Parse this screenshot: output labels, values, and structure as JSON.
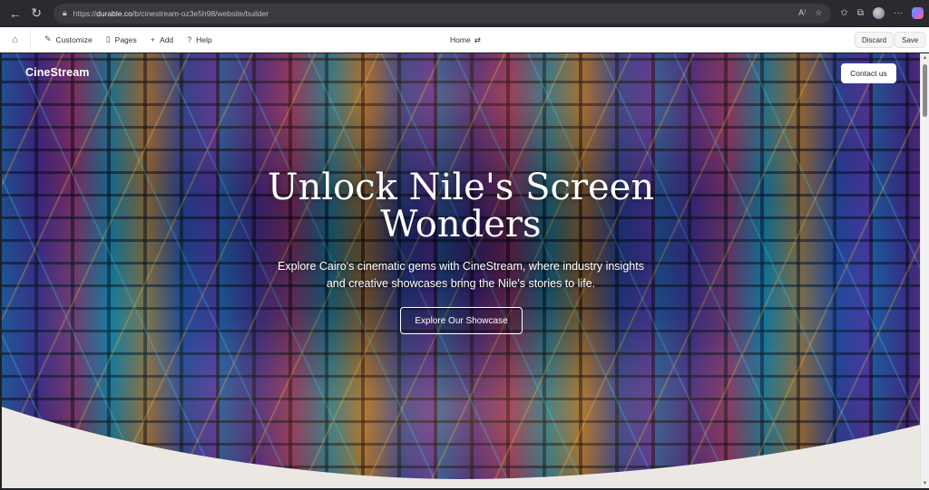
{
  "browser": {
    "url_protocol": "https://",
    "url_host": "durable.co",
    "url_path": "/b/cinestream-oz3e5h98/website/builder"
  },
  "toolbar": {
    "customize": "Customize",
    "pages": "Pages",
    "add": "Add",
    "help": "Help",
    "current_page": "Home",
    "discard": "Discard",
    "save": "Save"
  },
  "site": {
    "brand": "CineStream",
    "contact_label": "Contact us",
    "hero_title_line1": "Unlock Nile's Screen",
    "hero_title_line2": "Wonders",
    "hero_subtitle": "Explore Cairo's cinematic gems with CineStream, where industry insights and creative showcases bring the Nile's stories to life.",
    "cta_label": "Explore Our Showcase"
  },
  "colors": {
    "wave_fill": "#ebe8e4",
    "toolbar_bg": "#ffffff",
    "chrome_bg": "#2b2b2f"
  }
}
